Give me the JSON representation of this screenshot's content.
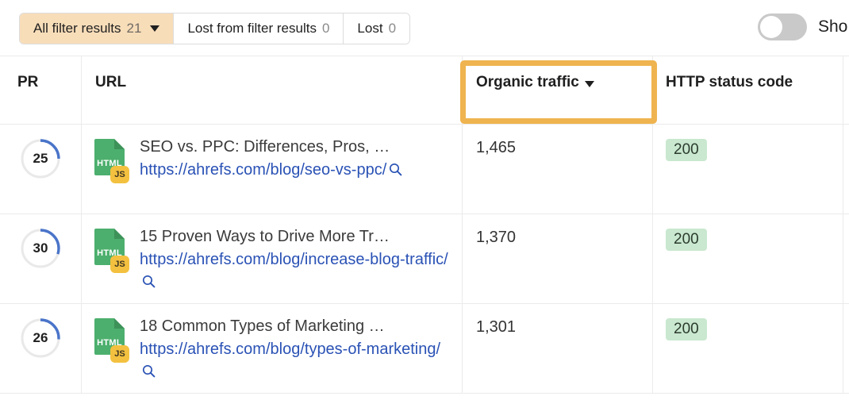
{
  "toolbar": {
    "tabs": [
      {
        "label": "All filter results",
        "count": "21",
        "active": true,
        "has_caret": true
      },
      {
        "label": "Lost from filter results",
        "count": "0",
        "active": false,
        "has_caret": false
      },
      {
        "label": "Lost",
        "count": "0",
        "active": false,
        "has_caret": false
      }
    ],
    "toggle": {
      "state": "off",
      "label": "Sho"
    }
  },
  "table": {
    "columns": [
      {
        "key": "pr",
        "label": "PR"
      },
      {
        "key": "url",
        "label": "URL"
      },
      {
        "key": "traffic",
        "label": "Organic traffic",
        "sorted": "desc",
        "highlighted": true
      },
      {
        "key": "status",
        "label": "HTTP status code"
      }
    ],
    "rows": [
      {
        "pr": "25",
        "pr_percent": 25,
        "file_type": "HTML",
        "file_badge": "JS",
        "title": "SEO vs. PPC: Differences, Pros, …",
        "url": "https://ahrefs.com/blog/seo-vs-ppc/",
        "traffic": "1,465",
        "status": "200"
      },
      {
        "pr": "30",
        "pr_percent": 30,
        "file_type": "HTML",
        "file_badge": "JS",
        "title": "15 Proven Ways to Drive More Tr…",
        "url": "https://ahrefs.com/blog/increase-blog-traffic/",
        "traffic": "1,370",
        "status": "200"
      },
      {
        "pr": "26",
        "pr_percent": 26,
        "file_type": "HTML",
        "file_badge": "JS",
        "title": "18 Common Types of Marketing …",
        "url": "https://ahrefs.com/blog/types-of-marketing/",
        "traffic": "1,301",
        "status": "200"
      }
    ]
  },
  "colors": {
    "active_tab_bg": "#f8ddb9",
    "highlight_border": "#efb450",
    "link": "#2a52b5",
    "gauge_arc": "#4a74c9",
    "gauge_track": "#e9e9e9",
    "status_bg": "#c9e8cf",
    "file_icon": "#4caf6d",
    "badge": "#f3c13f"
  }
}
